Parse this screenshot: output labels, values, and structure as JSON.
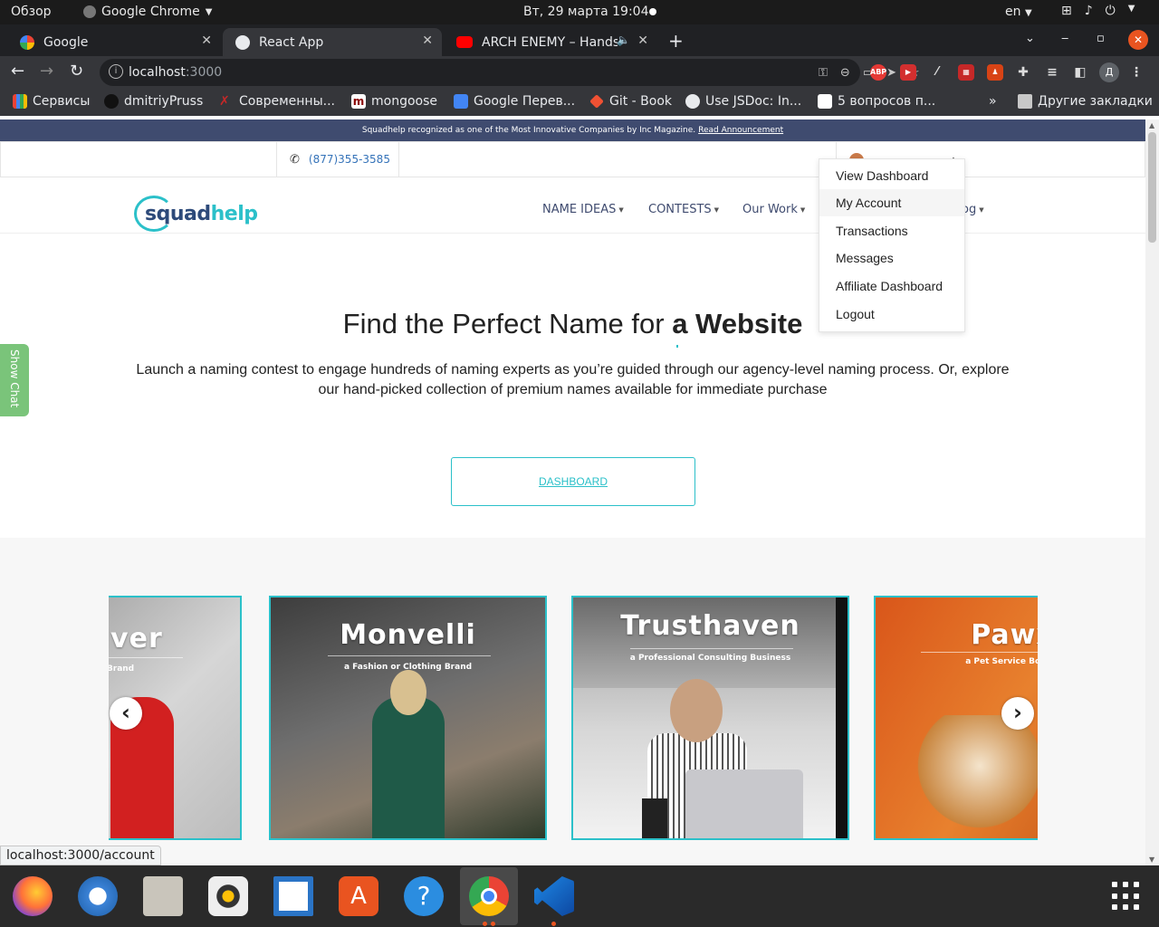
{
  "os": {
    "activities": "Обзор",
    "app_name": "Google Chrome",
    "clock": "Вт, 29 марта  19:04",
    "lang": "en"
  },
  "browser": {
    "tabs": [
      {
        "title": "Google"
      },
      {
        "title": "React App"
      },
      {
        "title": "ARCH ENEMY – Hands"
      }
    ],
    "url_host": "localhost",
    "url_port": ":3000",
    "profile_initial": "Д",
    "bookmarks": [
      {
        "label": "Сервисы"
      },
      {
        "label": "dmitriyPruss"
      },
      {
        "label": "Современны..."
      },
      {
        "label": "mongoose"
      },
      {
        "label": "Google Перев..."
      },
      {
        "label": "Git - Book"
      },
      {
        "label": "Use JSDoc: In..."
      },
      {
        "label": "5 вопросов п..."
      }
    ],
    "more_bookmarks": "»",
    "other_bookmarks": "Другие закладки",
    "status_url": "localhost:3000/account"
  },
  "site": {
    "banner_text": "Squadhelp recognized as one of the Most Innovative Companies by Inc Magazine.",
    "banner_link": "Read Announcement",
    "phone": "(877)355-3585",
    "logo_a": "squad",
    "logo_b": "help",
    "nav": [
      {
        "label": "NAME IDEAS"
      },
      {
        "label": "CONTESTS"
      },
      {
        "label": "Our Work"
      },
      {
        "label": "og"
      }
    ],
    "user_menu": [
      {
        "label": "View Dashboard"
      },
      {
        "label": "My Account"
      },
      {
        "label": "Transactions"
      },
      {
        "label": "Messages"
      },
      {
        "label": "Affiliate Dashboard"
      },
      {
        "label": "Logout"
      }
    ],
    "hero": {
      "title_prefix": "Find the Perfect Name for",
      "title_bold": "a Website",
      "description": "Launch a naming contest to engage hundreds of naming experts as you’re guided through our agency-level naming process. Or, explore our hand-picked collection of premium names available for immediate purchase",
      "button": "DASHBOARD"
    },
    "show_chat": "Show Chat",
    "cards": [
      {
        "name": "evolver",
        "sub": "lothing Brand"
      },
      {
        "name": "Monvelli",
        "sub": "a Fashion or Clothing Brand"
      },
      {
        "name": "Trusthaven",
        "sub": "a Professional Consulting Business"
      },
      {
        "name": "Pawx",
        "sub": "a Pet Service Bookin"
      }
    ],
    "prev_arrow": "‹",
    "next_arrow": "›"
  },
  "colors": {
    "accent": "#2bc0c9",
    "banner_bg": "#3f4b6f",
    "chat_bg": "#7ac47a"
  }
}
